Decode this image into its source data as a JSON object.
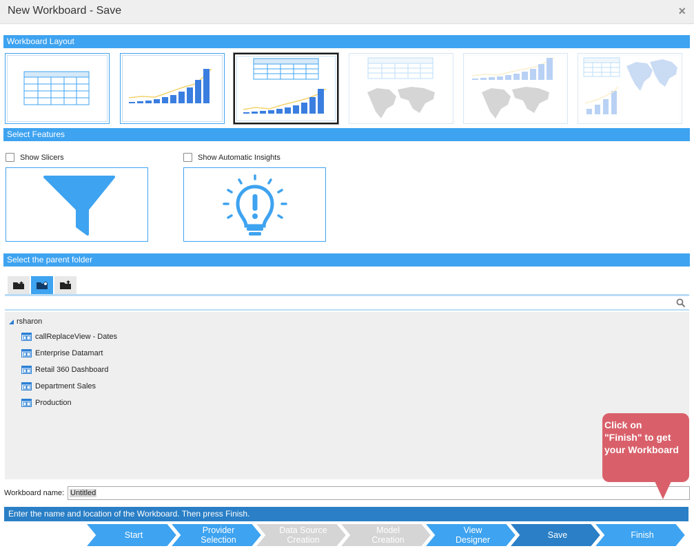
{
  "window": {
    "title": "New Workboard - Save",
    "close_glyph": "×"
  },
  "sections": {
    "layout": "Workboard Layout",
    "features": "Select Features",
    "folder": "Select the parent folder"
  },
  "layouts": [
    {
      "kind": "table",
      "state": "enabled"
    },
    {
      "kind": "chart",
      "state": "enabled"
    },
    {
      "kind": "table-chart",
      "state": "selected"
    },
    {
      "kind": "table-map",
      "state": "disabled"
    },
    {
      "kind": "chart-map",
      "state": "disabled"
    },
    {
      "kind": "table-chart-map",
      "state": "disabled"
    }
  ],
  "features": {
    "slicers": {
      "label": "Show Slicers",
      "checked": false,
      "icon": "funnel-icon"
    },
    "insights": {
      "label": "Show Automatic Insights",
      "checked": false,
      "icon": "lightbulb-icon"
    }
  },
  "folder_tabs": [
    {
      "icon": "folder-star-icon",
      "active": false
    },
    {
      "icon": "folder-shared-icon",
      "active": true
    },
    {
      "icon": "folder-up-icon",
      "active": false
    }
  ],
  "tree": {
    "root": "rsharon",
    "items": [
      "callReplaceView - Dates",
      "Enterprise Datamart",
      "Retail 360 Dashboard",
      "Department Sales",
      "Production"
    ]
  },
  "name_field": {
    "label": "Workboard name:",
    "value": "Untitled"
  },
  "status": "Enter the name and location of the Workboard. Then press Finish.",
  "wizard": [
    {
      "line1": "Start",
      "line2": "",
      "state": "enabled"
    },
    {
      "line1": "Provider",
      "line2": "Selection",
      "state": "enabled"
    },
    {
      "line1": "Data Source",
      "line2": "Creation",
      "state": "disabled"
    },
    {
      "line1": "Model",
      "line2": "Creation",
      "state": "disabled"
    },
    {
      "line1": "View",
      "line2": "Designer",
      "state": "enabled"
    },
    {
      "line1": "Save",
      "line2": "",
      "state": "current"
    },
    {
      "line1": "Finish",
      "line2": "",
      "state": "enabled"
    }
  ],
  "callout": {
    "line1": "Click on",
    "line2": "\"Finish\" to get",
    "line3": "your Workboard"
  },
  "colors": {
    "accent": "#3ea3f0",
    "step_enabled": "#3ea3f0",
    "step_disabled": "#d5d5d5",
    "step_current": "#2a7fc6",
    "callout": "#d9606a"
  }
}
